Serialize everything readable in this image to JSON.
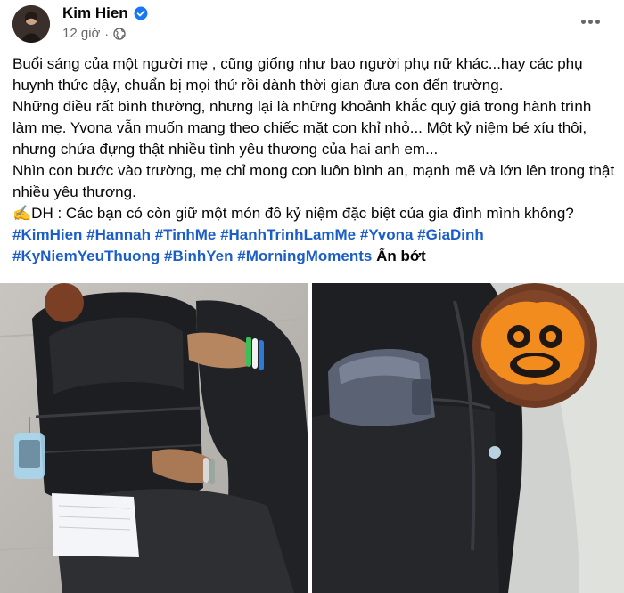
{
  "author": {
    "name": "Kim Hien",
    "verified": true
  },
  "post_meta": {
    "time": "12 giờ",
    "separator": "·",
    "audience_icon": "globe-icon"
  },
  "more_icon": "more-options-icon",
  "post": {
    "lines": [
      "Buổi sáng của một người mẹ , cũng giống như bao người phụ nữ khác...hay các phụ huynh thức dậy, chuẩn bị mọi thứ rồi dành thời gian đưa con đến trường.",
      "Những điều rất bình thường, nhưng lại là những khoảnh khắc quý giá trong hành trình làm mẹ. Yvona vẫn muốn mang theo chiếc mặt con khỉ nhỏ... Một kỷ niệm bé xíu thôi, nhưng chứa đựng thật nhiều tình yêu thương của hai anh em...",
      "Nhìn con bước vào trường, mẹ chỉ mong con luôn bình an, mạnh mẽ và lớn lên trong thật nhiều yêu thương.",
      "✍️DH : Các bạn có còn giữ một món đồ kỷ niệm đặc biệt của gia đình mình không?"
    ],
    "hashtags": [
      "#KimHien",
      "#Hannah",
      "#TinhMe",
      "#HanhTrinhLamMe",
      "#Yvona",
      "#GiaDinh",
      "#KyNiemYeuThuong",
      "#BinhYen",
      "#MorningMoments"
    ],
    "see_less": "Ẩn bớt"
  },
  "colors": {
    "hashtag": "#1b5ec7",
    "verified_badge": "#1877f2",
    "meta_text": "#65676b"
  }
}
